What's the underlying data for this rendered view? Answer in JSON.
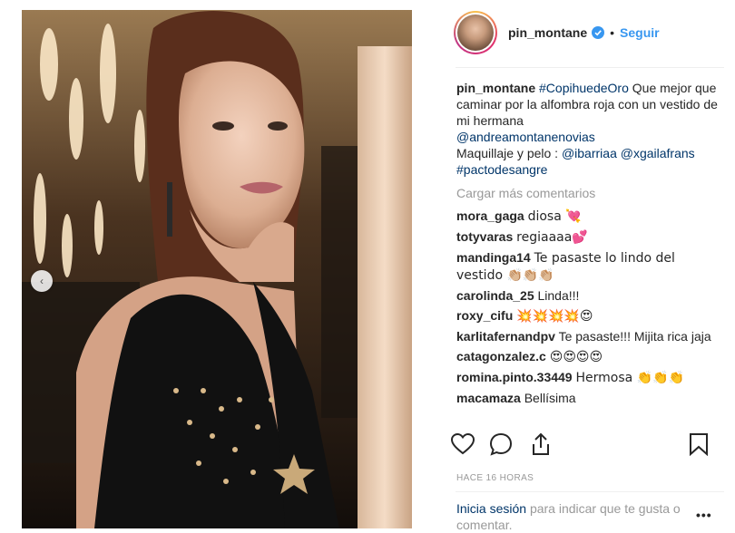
{
  "post": {
    "username": "pin_montane",
    "separator": "•",
    "follow_label": "Seguir",
    "caption_user": "pin_montane",
    "caption_hashtag": "#CopihuedeOro",
    "caption_text": "Que mejor que caminar por la alfombra roja con un vestido de mi hermana",
    "caption_mention": "@andreamontanenovias",
    "caption_makeup_label": "Maquillaje y pelo :",
    "caption_mention2": "@ibarriaa",
    "caption_mention3": "@xgailafrans",
    "caption_hashtag2": "#pactodesangre",
    "load_more": "Cargar más comentarios",
    "timestamp": "HACE 16 HORAS",
    "login_link": "Inicia sesión",
    "login_text": "para indicar que te gusta o comentar.",
    "menu_dots": "•••"
  },
  "comments": [
    {
      "user": "mora_gaga",
      "text": "diosa 💘"
    },
    {
      "user": "totyvaras",
      "text": "regiaaaa💕"
    },
    {
      "user": "mandinga14",
      "text": "Te pasaste lo lindo del vestido 👏🏼👏🏼👏🏼"
    },
    {
      "user": "carolinda_25",
      "text": "Linda!!!"
    },
    {
      "user": "roxy_cifu",
      "text": "💥💥💥💥😍"
    },
    {
      "user": "karlitafernandpv",
      "text": "Te pasaste!!! Mijita rica jaja"
    },
    {
      "user": "catagonzalez.c",
      "text": "😍😍😍😍"
    },
    {
      "user": "romina.pinto.33449",
      "text": "Hermosa 👏👏👏"
    },
    {
      "user": "macamaza",
      "text": "Bellísima"
    }
  ],
  "icons": {
    "like": "heart-icon",
    "comment": "comment-icon",
    "share": "share-icon",
    "save": "bookmark-icon",
    "verified": "verified-badge-icon",
    "prev": "chevron-left-icon"
  },
  "colors": {
    "link": "#003569",
    "follow": "#3897f0",
    "muted": "#999999",
    "verified": "#3897f0"
  },
  "carousel": {
    "count": 2,
    "active": 2
  }
}
